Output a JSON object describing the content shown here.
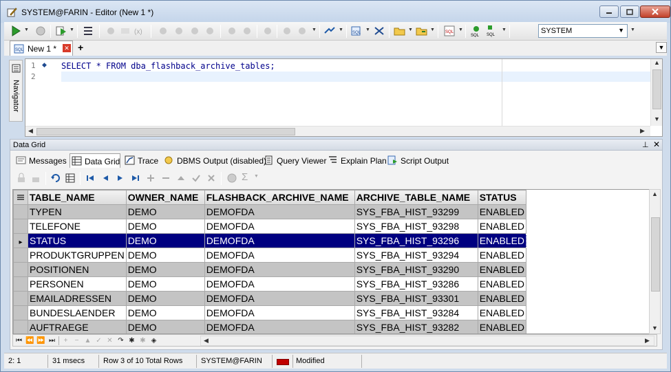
{
  "window": {
    "title": "SYSTEM@FARIN - Editor (New 1 *)"
  },
  "toolbar": {
    "connection": "SYSTEM"
  },
  "tabs": {
    "document_tab": "New 1 *",
    "add_tab": "+"
  },
  "navigator": {
    "label": "Navigator"
  },
  "editor": {
    "line_numbers": [
      "1",
      "2"
    ],
    "code": "SELECT * FROM dba_flashback_archive_tables;"
  },
  "data_grid": {
    "panel_title": "Data Grid",
    "subtabs": [
      "Messages",
      "Data Grid",
      "Trace",
      "DBMS Output (disabled)",
      "Query Viewer",
      "Explain Plan",
      "Script Output"
    ],
    "columns": [
      "TABLE_NAME",
      "OWNER_NAME",
      "FLASHBACK_ARCHIVE_NAME",
      "ARCHIVE_TABLE_NAME",
      "STATUS"
    ],
    "rows": [
      [
        "TYPEN",
        "DEMO",
        "DEMOFDA",
        "SYS_FBA_HIST_93299",
        "ENABLED"
      ],
      [
        "TELEFONE",
        "DEMO",
        "DEMOFDA",
        "SYS_FBA_HIST_93298",
        "ENABLED"
      ],
      [
        "STATUS",
        "DEMO",
        "DEMOFDA",
        "SYS_FBA_HIST_93296",
        "ENABLED"
      ],
      [
        "PRODUKTGRUPPEN",
        "DEMO",
        "DEMOFDA",
        "SYS_FBA_HIST_93294",
        "ENABLED"
      ],
      [
        "POSITIONEN",
        "DEMO",
        "DEMOFDA",
        "SYS_FBA_HIST_93290",
        "ENABLED"
      ],
      [
        "PERSONEN",
        "DEMO",
        "DEMOFDA",
        "SYS_FBA_HIST_93286",
        "ENABLED"
      ],
      [
        "EMAILADRESSEN",
        "DEMO",
        "DEMOFDA",
        "SYS_FBA_HIST_93301",
        "ENABLED"
      ],
      [
        "BUNDESLAENDER",
        "DEMO",
        "DEMOFDA",
        "SYS_FBA_HIST_93284",
        "ENABLED"
      ],
      [
        "AUFTRAEGE",
        "DEMO",
        "DEMOFDA",
        "SYS_FBA_HIST_93282",
        "ENABLED"
      ]
    ],
    "selected_row": 2
  },
  "status": {
    "position": "2:   1",
    "time": "31 msecs",
    "rows": "Row 3 of 10 Total Rows",
    "connection": "SYSTEM@FARIN",
    "state": "Modified"
  },
  "colors": {
    "selection": "#000080",
    "title_gradient": "#c4d5ea",
    "close_button": "#c2412a"
  }
}
